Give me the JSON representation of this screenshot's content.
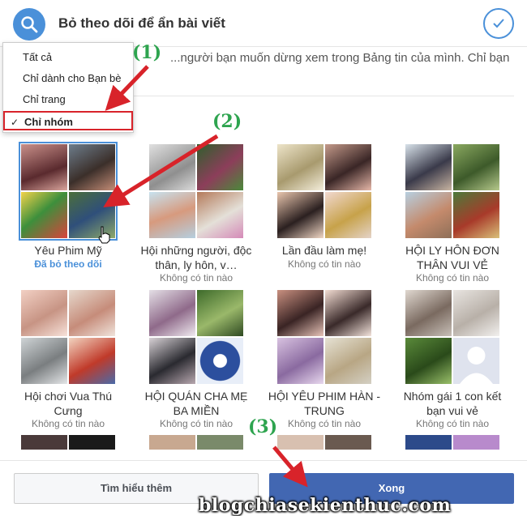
{
  "header": {
    "title": "Bỏ theo dõi để ẩn bài viết",
    "icon": "search-icon",
    "confirm_icon": "check-icon"
  },
  "description": "...người bạn muốn dừng xem trong Bảng tin của mình. Chỉ bạn",
  "filter_menu": {
    "items": [
      {
        "label": "Tất cả"
      },
      {
        "label": "Chỉ dành cho Bạn bè"
      },
      {
        "label": "Chỉ trang"
      },
      {
        "label": "Chỉ nhóm",
        "checked": true
      }
    ]
  },
  "annotations": {
    "step1": "(1)",
    "step2": "(2)",
    "step3": "(3)"
  },
  "groups": [
    {
      "name": "Yêu Phim Mỹ",
      "status": "Đã bỏ theo dõi",
      "status_color": "#4a90d9",
      "selected": true
    },
    {
      "name": "Hội những người, độc thân, ly hôn, v…",
      "status": "Không có tin nào"
    },
    {
      "name": "Lần đầu làm mẹ!",
      "status": "Không có tin nào"
    },
    {
      "name": "HỘI LY HÔN  ĐƠN THÂN  VUI VẺ",
      "status": "Không có tin nào"
    },
    {
      "name": "Hội chơi Vua Thú Cưng",
      "status": "Không có tin nào"
    },
    {
      "name": "HỘI QUÁN CHA MẸ BA MIỀN",
      "status": "Không có tin nào"
    },
    {
      "name": "HỘI YÊU PHIM HÀN -TRUNG",
      "status": "Không có tin nào"
    },
    {
      "name": "Nhóm gái 1 con kết bạn vui vẻ",
      "status": "Không có tin nào"
    }
  ],
  "footer": {
    "learn_more": "Tìm hiểu thêm",
    "done": "Xong",
    "done_color": "#4267b2"
  },
  "watermark": "blogchiasekienthuc.com",
  "colors": {
    "accent": "#4a90d9",
    "annotation_green": "#2ea44f",
    "annotation_red": "#d8232a"
  }
}
